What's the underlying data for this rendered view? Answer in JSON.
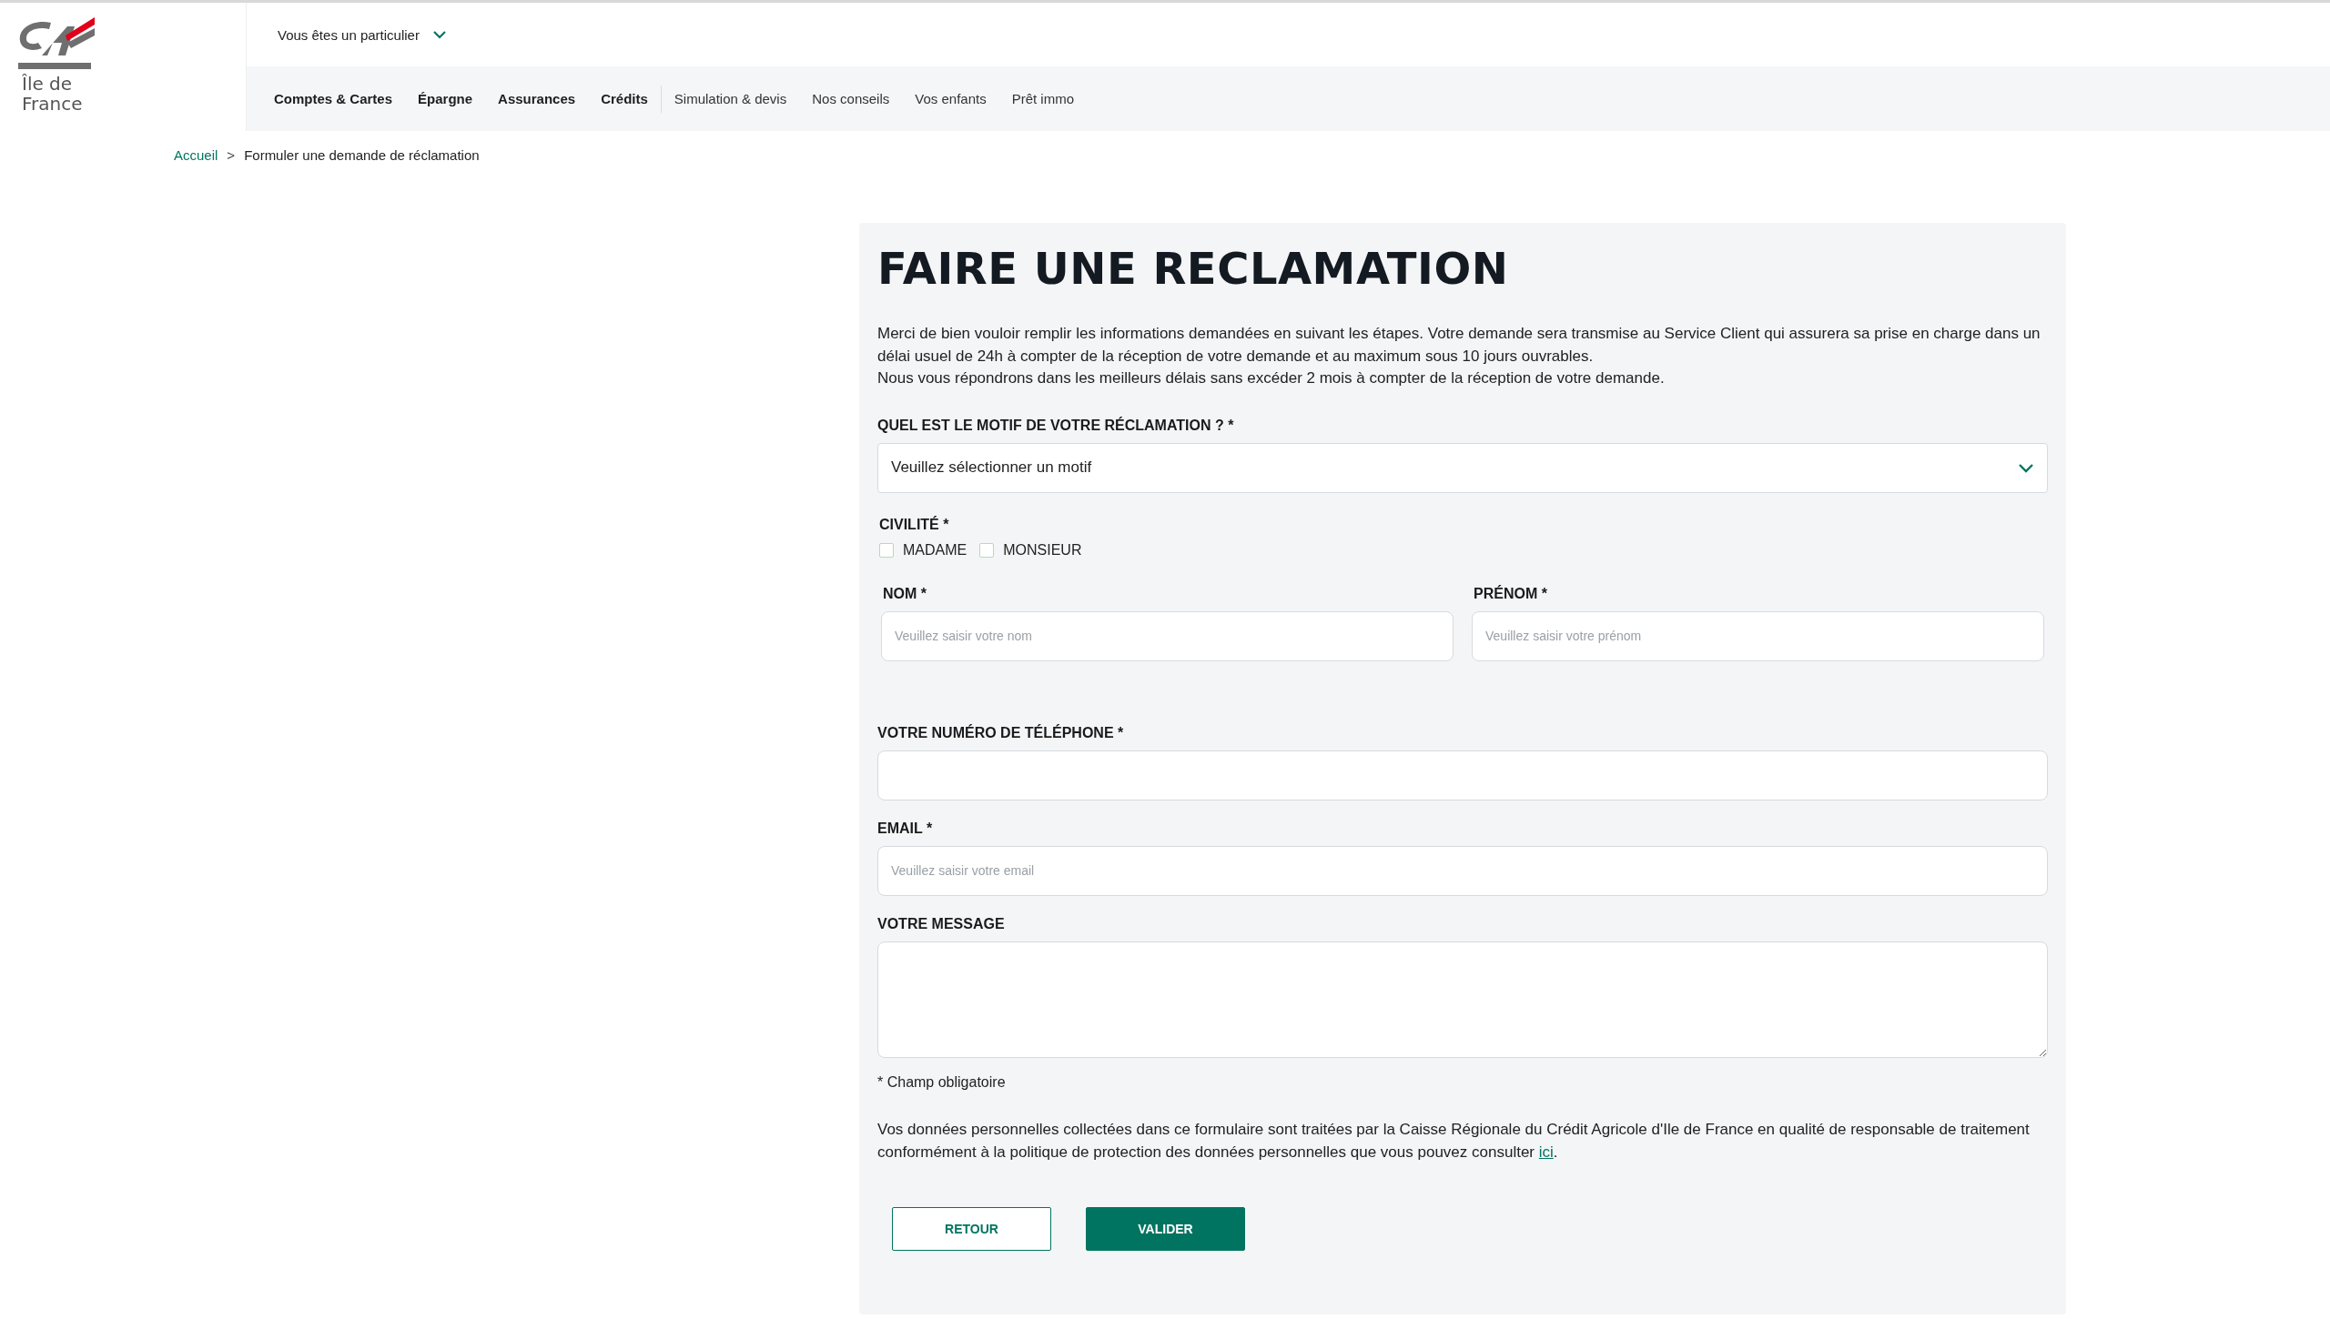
{
  "logo": {
    "region_line1": "Île de",
    "region_line2": "France"
  },
  "header": {
    "profile_selector": "Vous êtes un particulier"
  },
  "nav": [
    {
      "label": "Comptes & Cartes",
      "bold": true
    },
    {
      "label": "Épargne",
      "bold": true
    },
    {
      "label": "Assurances",
      "bold": true
    },
    {
      "label": "Crédits",
      "bold": true
    },
    {
      "label": "Simulation & devis",
      "bold": false
    },
    {
      "label": "Nos conseils",
      "bold": false
    },
    {
      "label": "Vos enfants",
      "bold": false
    },
    {
      "label": "Prêt immo",
      "bold": false
    }
  ],
  "breadcrumb": {
    "home": "Accueil",
    "separator": ">",
    "current": "Formuler une demande de réclamation"
  },
  "form": {
    "title": "FAIRE UNE RECLAMATION",
    "intro": [
      "Merci de bien vouloir remplir les informations demandées en suivant les étapes. Votre demande sera transmise au Service Client qui assurera sa prise en charge dans un délai usuel de 24h à compter de la réception de votre demande et au maximum sous 10 jours ouvrables.",
      "Nous vous répondrons dans les meilleurs délais sans excéder 2 mois à compter de la réception de votre demande."
    ],
    "reason": {
      "label": "QUEL EST LE MOTIF DE VOTRE RÉCLAMATION ? *",
      "value": "Veuillez sélectionner un motif"
    },
    "civility": {
      "label": "CIVILITÉ *",
      "options": [
        {
          "label": "MADAME",
          "checked": false
        },
        {
          "label": "MONSIEUR",
          "checked": false
        }
      ]
    },
    "last_name": {
      "label": "NOM *",
      "placeholder": "Veuillez saisir votre nom"
    },
    "first_name": {
      "label": "PRÉNOM *",
      "placeholder": "Veuillez saisir votre prénom"
    },
    "phone": {
      "label": "VOTRE NUMÉRO DE TÉLÉPHONE *"
    },
    "email": {
      "label": "EMAIL *",
      "placeholder": "Veuillez saisir votre email"
    },
    "message": {
      "label": "VOTRE MESSAGE"
    },
    "required_note": "* Champ obligatoire",
    "privacy": {
      "text": "Vos données personnelles collectées dans ce formulaire sont traitées par la Caisse Régionale du Crédit Agricole d'Ile de France en qualité de responsable de traitement conformément à la politique de protection des données personnelles que vous pouvez consulter",
      "link": "ici",
      "end": "."
    },
    "buttons": {
      "back": "RETOUR",
      "submit": "VALIDER"
    }
  }
}
